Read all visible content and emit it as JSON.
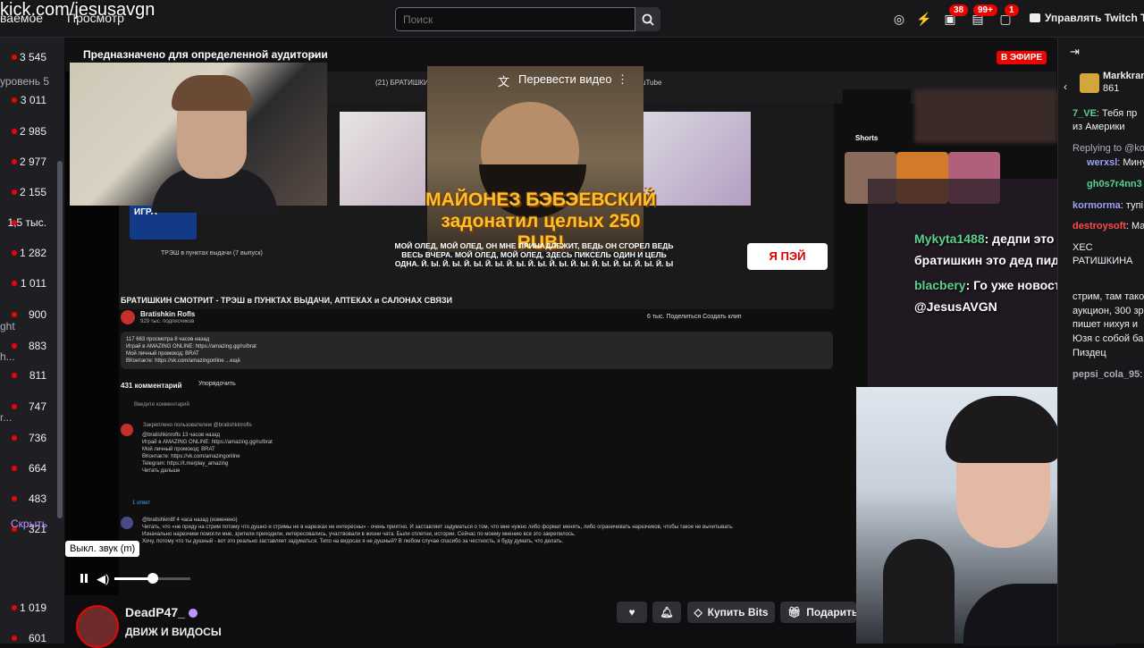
{
  "overlay_url": "kick.com/jesusavgn",
  "topbar": {
    "nav_following_fragment": "ваемое",
    "nav_browse": "Просмотр",
    "search_placeholder": "Поиск",
    "badges": {
      "notifications": "38",
      "inbox": "99+",
      "whispers": "1"
    },
    "turbo_label": "Управлять Twitch Tu"
  },
  "sidebar": {
    "items": [
      {
        "count": "3 545"
      },
      {
        "count": "3 011"
      },
      {
        "count": "2 985"
      },
      {
        "count": "2 977"
      },
      {
        "count": "2 155"
      },
      {
        "count": "1,5 тыс."
      },
      {
        "count": "1 282"
      },
      {
        "count": "1 011"
      },
      {
        "count": "900"
      },
      {
        "count": "883"
      },
      {
        "count": "811"
      },
      {
        "count": "747"
      },
      {
        "count": "736"
      },
      {
        "count": "664"
      },
      {
        "count": "483"
      },
      {
        "count": "321"
      },
      {
        "count": "1 019"
      },
      {
        "count": "601"
      }
    ],
    "fragments": [
      "уровень 5",
      "ght",
      "h...",
      "r..."
    ],
    "hide_label": "Скрыть"
  },
  "player": {
    "audience_label": "Предназначено для определенной аудитории",
    "live_badge": "В ЭФИРЕ",
    "translate_label": "Перевести видео",
    "yt_tab_left": "(21) БРАТИШКИ",
    "yt_tab_right": "uTube",
    "thumb_headline": "МАЙОНЕЗ БЭБЭЕВСКИЙ задонатил целых 250 RUB!",
    "thumb_subtitle": "МОЙ ОЛЕД, МОЙ ОЛЕД, ОН МНЕ ПРИНАДЛЕЖИТ, ВЕДЬ ОН СГОРЕЛ ВЕДЬ ВЕСЬ ВЧЕРА. МОЙ ОЛЕД, МОЙ ОЛЕД, ЗДЕСЬ ПИКСЕЛЬ ОДИН И ЦЕЛЬ ОДНА. Й. Ы. Й. Ы. Й. Ы. Й. Ы. Й. Ы. Й. Ы. Й. Ы. Й. Ы. Й. Ы. Й. Ы. Й. Ы. Й. Ы",
    "ad_brand": "Я ПЭЙ",
    "game_card": "ИГРА",
    "trash_caption": "ТРЭШ в пунктах выдачи (7 выпуск)",
    "yt_video_title": "БРАТИШКИН СМОТРИТ - ТРЭШ в ПУНКТАХ ВЫДАЧИ, АПТЕКАХ и САЛОНАХ СВЯЗИ",
    "yt_channel": "Bratishkin Rofls",
    "yt_subs": "929 тыс. подписчиков",
    "yt_actions": "6 тыс.    Поделиться    Создать клип",
    "yt_desc_lines": [
      "117 663 просмотра  8 часов назад",
      "Играй в AMAZING ONLINE: https://amazing.gg/ru/brat",
      "Мой личный промокод: BRAT",
      "ВКонтакте: https://vk.com/amazingonline ...ещё"
    ],
    "yt_comment_count": "431 комментарий",
    "yt_sort": "Упорядочить",
    "yt_add_comment": "Введите комментарий",
    "yt_pinned": "Закреплено пользователем @bratishkinrofls",
    "yt_comment1_lines": [
      "@bratishkinrofls  13 часов назад",
      "Играй в AMAZING ONLINE: https://amazing.gg/ru/brat",
      "Мой личный промокод: BRAT",
      "ВКонтакте: https://vk.com/amazingonline",
      "Telegram: https://t.me/play_amazing",
      "Читать дальше"
    ],
    "yt_reply": "1 ответ",
    "yt_comment2_lines": [
      "@bratishkin8f  4 часа назад (изменено)",
      "Читать, что «не приду на стрим потому что душно и стримы не в нарезках не интересны» - очень приятно. И заставляет задуматься о том, что мне нужно либо формат менять, либо ограничивать нарезчиков, чтобы такое не вычитывать.",
      "Изначально нарезчики помогли мне, зрители приходили, интересовались, участвовали в жизни чата. Были сплетни, истории. Сейчас по моему мнению все это закрепилось.",
      "Хочу, потому что ты душный - вот это реально заставляет задуматься. Типо на видосах я не душный? В любом случае спасибо за честность, я буду думать, что делать."
    ],
    "shorts_label": "Shorts"
  },
  "stream_chat_overlay": [
    {
      "user": "Mykyta1488",
      "text": ": дедпи это дедпи, а"
    },
    {
      "user": "",
      "text": "братишкин это дед пидор"
    },
    {
      "user": "blacbery",
      "text": ": Го уже новости ХЕС ?"
    },
    {
      "user": "",
      "text": "@JesusAVGN"
    }
  ],
  "chat": {
    "header_user": "Markkran",
    "header_count": "861",
    "lines": [
      {
        "user": "7_VE",
        "text": ": Тебя пр",
        "color": "#59d18f"
      },
      {
        "user": "",
        "text": "из Америки",
        "color": "#efeff1"
      },
      {
        "user": "",
        "text": "Replying to @ko",
        "color": "#adadb8"
      },
      {
        "user": "werxsl",
        "text": ": Мину",
        "color": "#9aa2f2"
      },
      {
        "user": "gh0s7r4nn3",
        "text": "",
        "color": "#59d18f"
      },
      {
        "user": "kormorma",
        "text": ": тупі",
        "color": "#9aa2f2"
      },
      {
        "user": "destroysoft",
        "text": ": Ма",
        "color": "#ff4a4a"
      },
      {
        "user": "",
        "text": "ХЕС",
        "color": "#efeff1"
      },
      {
        "user": "",
        "text": "РАТИШКИНА",
        "color": "#efeff1"
      },
      {
        "user": "",
        "text": "стрим, там тако",
        "color": "#efeff1"
      },
      {
        "user": "",
        "text": "аукцион, 300 зр",
        "color": "#efeff1"
      },
      {
        "user": "",
        "text": "пишет нихуя и",
        "color": "#efeff1"
      },
      {
        "user": "",
        "text": "Юзя с собой ба",
        "color": "#efeff1"
      },
      {
        "user": "",
        "text": "Пиздец",
        "color": "#efeff1"
      },
      {
        "user": "pepsi_cola_95",
        "text": ": п",
        "color": "#adadb8"
      }
    ]
  },
  "controls": {
    "mute_tooltip": "Выкл. звук (m)",
    "volume_level": 0.5
  },
  "streamer": {
    "name": "DeadP47_",
    "title": "ДВИЖ И ВИДОСЫ",
    "bits_label": "Купить Bits",
    "gift_label": "Подарить п"
  }
}
